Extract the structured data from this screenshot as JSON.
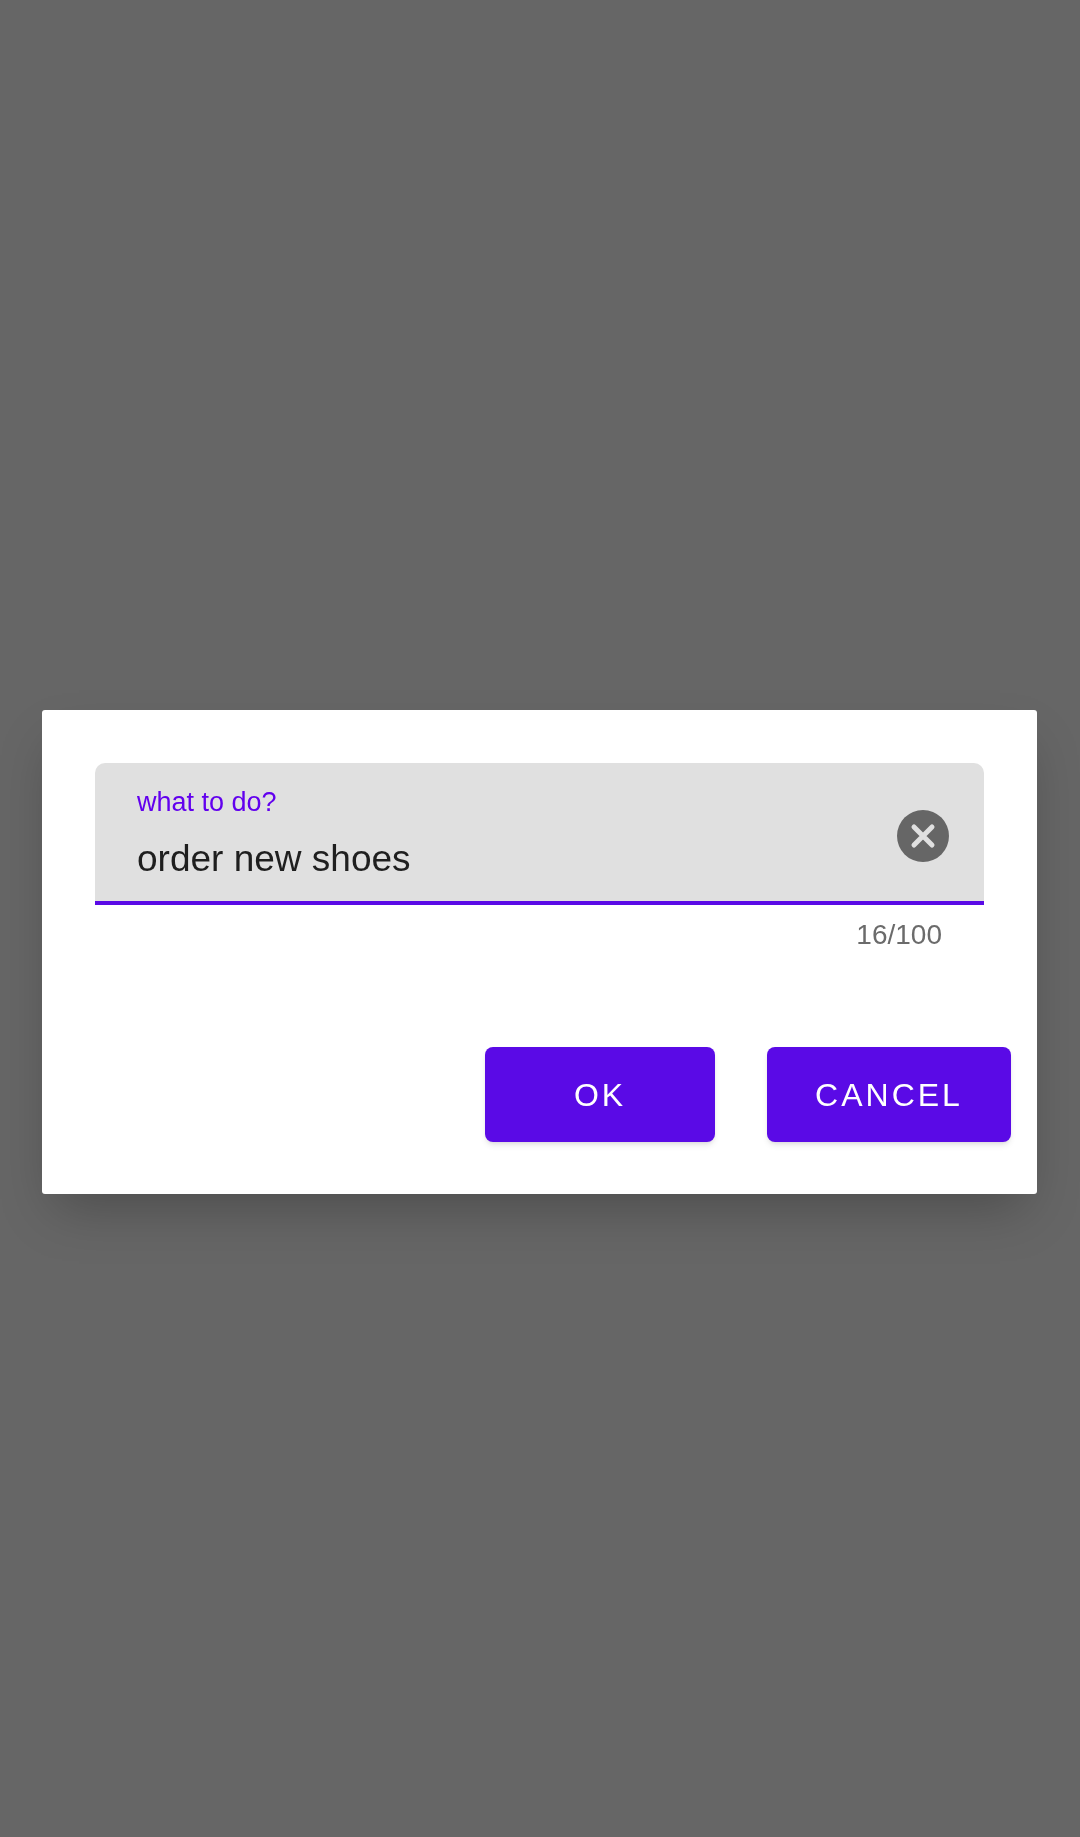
{
  "dialog": {
    "field": {
      "label": "what to do?",
      "value": "order new shoes",
      "focused": true,
      "counter": "16/100"
    },
    "buttons": [
      {
        "label": "OK"
      },
      {
        "label": "CANCEL"
      }
    ]
  }
}
